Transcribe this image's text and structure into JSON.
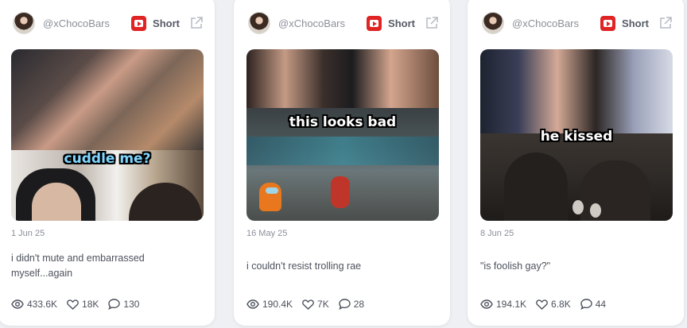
{
  "cards": [
    {
      "handle": "@xChocoBars",
      "type_label": "Short",
      "caption": "cuddle me?",
      "date": "1 Jun 25",
      "description": "i didn't mute and embarrassed myself...again",
      "views": "433.6K",
      "likes": "18K",
      "comments": "130"
    },
    {
      "handle": "@xChocoBars",
      "type_label": "Short",
      "caption": "this looks bad",
      "date": "16 May 25",
      "description": "i couldn't resist trolling rae",
      "views": "190.4K",
      "likes": "7K",
      "comments": "28"
    },
    {
      "handle": "@xChocoBars",
      "type_label": "Short",
      "caption": "he kissed",
      "date": "8 Jun 25",
      "description": "\"is foolish gay?\"",
      "views": "194.1K",
      "likes": "6.8K",
      "comments": "44"
    }
  ],
  "icons": {
    "platform": "youtube-icon",
    "external": "external-link-icon",
    "views": "eye-icon",
    "likes": "heart-icon",
    "comments": "comment-icon"
  },
  "colors": {
    "youtube_red": "#e02424",
    "caption_blue": "#7fd6ff"
  }
}
